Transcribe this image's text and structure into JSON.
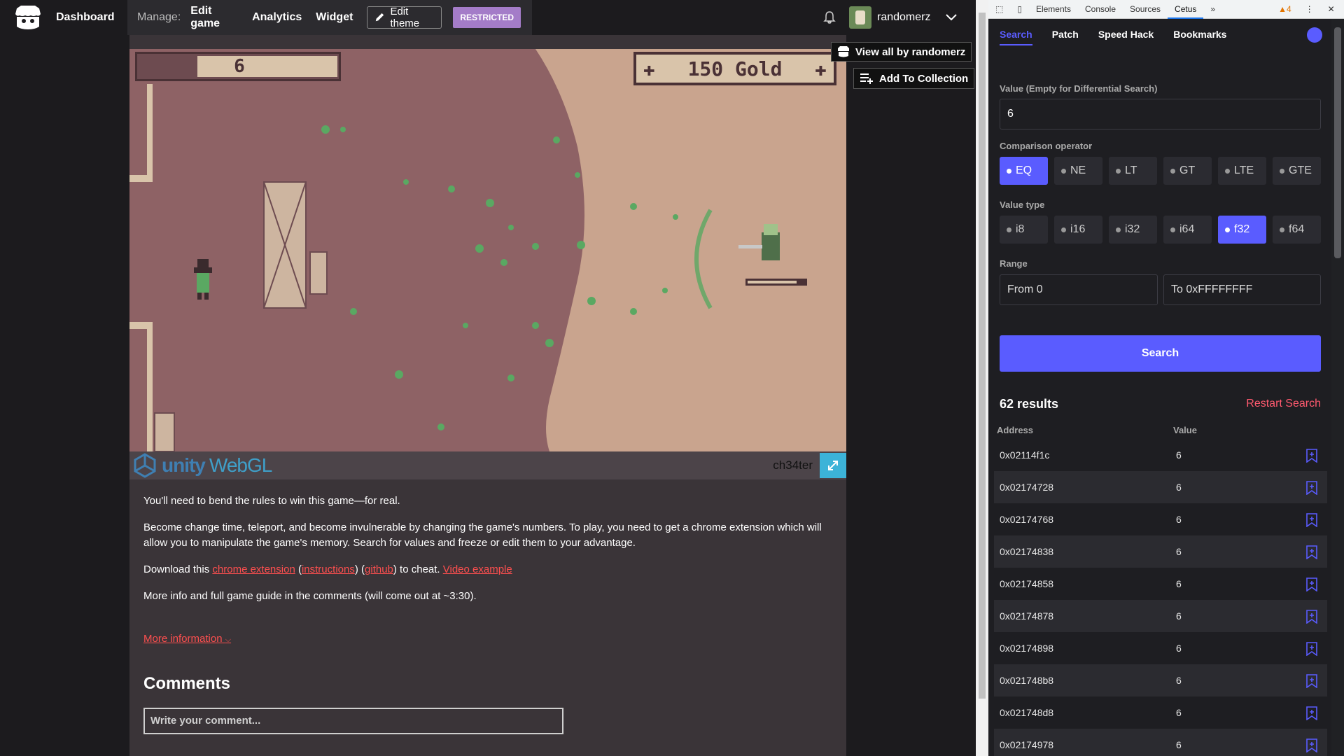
{
  "topbar": {
    "dashboard": "Dashboard",
    "manage_label": "Manage:",
    "links": [
      "Edit game",
      "Analytics",
      "Widget"
    ],
    "edit_theme": "Edit theme",
    "restricted": "RESTRICTED",
    "username": "randomerz"
  },
  "game": {
    "hud_left_value": "6",
    "hud_right_value": "150 Gold",
    "engine_word": "unity",
    "engine_variant": "WebGL",
    "name": "ch34ter"
  },
  "side_buttons": {
    "view_all": "View all by randomerz",
    "add_collection": "Add To Collection"
  },
  "description": {
    "p1": "You'll need to bend the rules to win this game—for real.",
    "p2": "Become change time, teleport, and become invulnerable by changing the game's numbers. To play, you need to get a chrome extension which will allow you to manipulate the game's memory. Search for values and freeze or edit them to your advantage.",
    "p3_prefix": "Download this ",
    "p3_link1": "chrome extension",
    "p3_mid1": " (",
    "p3_link2": "instructions",
    "p3_mid2": ") (",
    "p3_link3": "github",
    "p3_mid3": ") to cheat. ",
    "p3_link4": "Video example",
    "p4": "More info and full game guide in the comments (will come out at ~3:30).",
    "more_info": "More information"
  },
  "comments": {
    "heading": "Comments",
    "placeholder": "Write your comment..."
  },
  "devtools": {
    "tabs": [
      "Elements",
      "Console",
      "Sources",
      "Cetus"
    ],
    "warnings": "4",
    "active_tab": "Cetus"
  },
  "cetus": {
    "tabs": [
      "Search",
      "Patch",
      "Speed Hack",
      "Bookmarks"
    ],
    "value_label": "Value (Empty for Differential Search)",
    "value": "6",
    "operator_label": "Comparison operator",
    "operators": [
      "EQ",
      "NE",
      "LT",
      "GT",
      "LTE",
      "GTE"
    ],
    "selected_operator": "EQ",
    "type_label": "Value type",
    "types": [
      "i8",
      "i16",
      "i32",
      "i64",
      "f32",
      "f64"
    ],
    "selected_type": "f32",
    "range_label": "Range",
    "range_from": "From 0",
    "range_to": "To 0xFFFFFFFF",
    "search_button": "Search",
    "results_count": "62 results",
    "restart": "Restart Search",
    "col_address": "Address",
    "col_value": "Value",
    "results": [
      {
        "address": "0x02114f1c",
        "value": "6"
      },
      {
        "address": "0x02174728",
        "value": "6"
      },
      {
        "address": "0x02174768",
        "value": "6"
      },
      {
        "address": "0x02174838",
        "value": "6"
      },
      {
        "address": "0x02174858",
        "value": "6"
      },
      {
        "address": "0x02174878",
        "value": "6"
      },
      {
        "address": "0x02174898",
        "value": "6"
      },
      {
        "address": "0x021748b8",
        "value": "6"
      },
      {
        "address": "0x021748d8",
        "value": "6"
      },
      {
        "address": "0x02174978",
        "value": "6"
      }
    ],
    "accent_color": "#5a5cff",
    "restart_color": "#ff5a6f"
  }
}
